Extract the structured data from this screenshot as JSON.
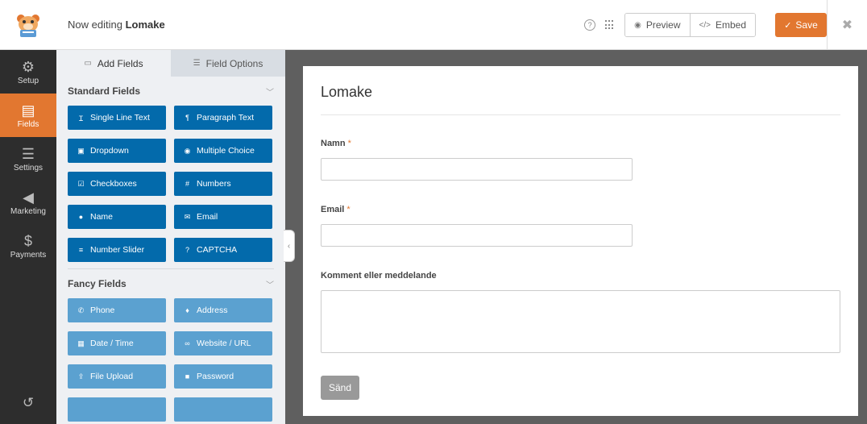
{
  "header": {
    "title_prefix": "Now editing",
    "form_name": "Lomake",
    "preview_label": "Preview",
    "embed_label": "Embed",
    "save_label": "Save"
  },
  "sidebar": {
    "items": [
      {
        "label": "Setup",
        "icon": "gear-icon"
      },
      {
        "label": "Fields",
        "icon": "fields-icon",
        "active": true
      },
      {
        "label": "Settings",
        "icon": "sliders-icon"
      },
      {
        "label": "Marketing",
        "icon": "megaphone-icon"
      },
      {
        "label": "Payments",
        "icon": "dollar-icon"
      }
    ]
  },
  "panel": {
    "tabs": [
      {
        "label": "Add Fields",
        "active": true
      },
      {
        "label": "Field Options",
        "active": false
      }
    ],
    "standard_title": "Standard Fields",
    "standard_fields": [
      {
        "label": "Single Line Text",
        "icon": "text-cursor-icon"
      },
      {
        "label": "Paragraph Text",
        "icon": "paragraph-icon"
      },
      {
        "label": "Dropdown",
        "icon": "dropdown-icon"
      },
      {
        "label": "Multiple Choice",
        "icon": "radio-icon"
      },
      {
        "label": "Checkboxes",
        "icon": "checkbox-icon"
      },
      {
        "label": "Numbers",
        "icon": "hash-icon"
      },
      {
        "label": "Name",
        "icon": "user-icon"
      },
      {
        "label": "Email",
        "icon": "envelope-icon"
      },
      {
        "label": "Number Slider",
        "icon": "slider-icon"
      },
      {
        "label": "CAPTCHA",
        "icon": "question-icon"
      }
    ],
    "fancy_title": "Fancy Fields",
    "fancy_fields": [
      {
        "label": "Phone",
        "icon": "phone-icon"
      },
      {
        "label": "Address",
        "icon": "map-pin-icon"
      },
      {
        "label": "Date / Time",
        "icon": "calendar-icon"
      },
      {
        "label": "Website / URL",
        "icon": "link-icon"
      },
      {
        "label": "File Upload",
        "icon": "upload-icon"
      },
      {
        "label": "Password",
        "icon": "lock-icon"
      }
    ]
  },
  "form": {
    "title": "Lomake",
    "fields": [
      {
        "label": "Namn",
        "required": "*"
      },
      {
        "label": "Email",
        "required": "*"
      },
      {
        "label": "Komment eller meddelande",
        "required": ""
      }
    ],
    "submit_label": "Sänd"
  },
  "colors": {
    "accent": "#e27730",
    "field_button": "#036aab",
    "fancy_button": "#5ba1d0",
    "sidebar_bg": "#2d2d2d"
  }
}
